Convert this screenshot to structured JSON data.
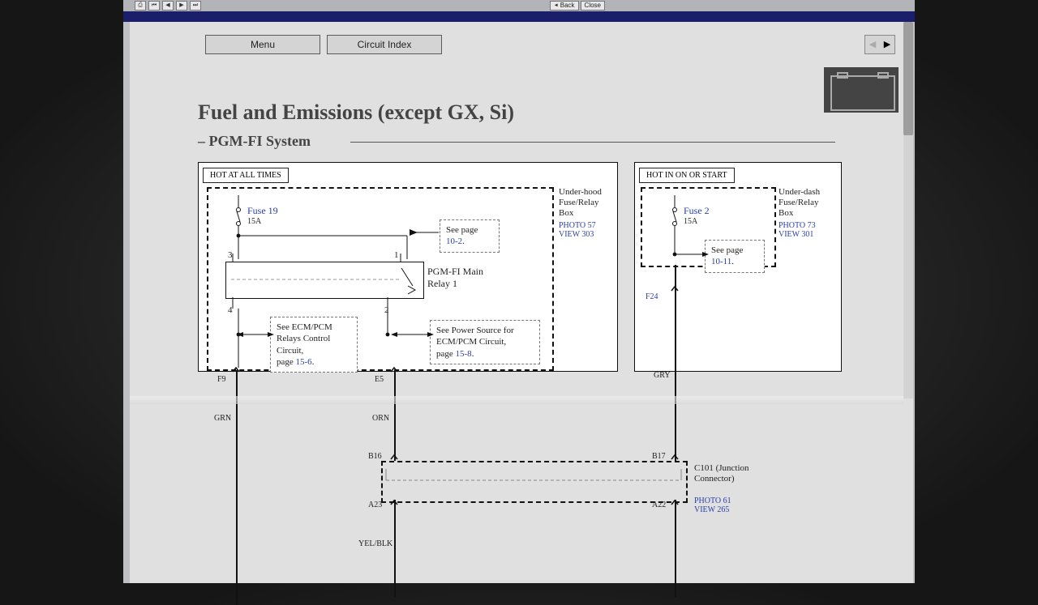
{
  "toolbar": {
    "back": "Back",
    "close": "Close"
  },
  "menu": {
    "item1": "Menu",
    "item2": "Circuit Index"
  },
  "title": "Fuel and Emissions (except GX, Si)",
  "subtitle": "– PGM-FI System",
  "panels": {
    "left": {
      "hot": "HOT AT ALL TIMES",
      "box_label": "Under-hood Fuse/Relay Box",
      "box_refs": [
        "PHOTO 57",
        "VIEW 303"
      ],
      "fuse": {
        "name": "Fuse 19",
        "rating": "15A"
      },
      "seepage1": {
        "pre": "See page",
        "page": "10-2",
        "post": "."
      },
      "relay": "PGM-FI Main Relay 1",
      "ref_left": {
        "text": "See ECM/PCM Relays Control Circuit,",
        "pagepre": "page",
        "page": "15-6",
        "post": "."
      },
      "ref_right": {
        "text": "See Power Source for ECM/PCM Circuit,",
        "pagepre": "page",
        "page": "15-8",
        "post": "."
      },
      "pins": {
        "p1": "1",
        "p2": "2",
        "p3": "3",
        "p4": "4"
      },
      "out_left": "F9",
      "out_right": "E5",
      "wire_left": "GRN",
      "wire_right": "ORN"
    },
    "right": {
      "hot": "HOT IN ON OR START",
      "box_label": "Under-dash Fuse/Relay Box",
      "box_refs": [
        "PHOTO 73",
        "VIEW 301"
      ],
      "fuse": {
        "name": "Fuse 2",
        "rating": "15A"
      },
      "seepage": {
        "pre": "See page",
        "page": "10-11",
        "post": "."
      },
      "out": "F24",
      "wire": "GRY"
    }
  },
  "junction": {
    "top_left": "B16",
    "top_right": "B17",
    "bot_left": "A23",
    "bot_right": "A22",
    "label": "C101 (Junction Connector)",
    "refs": [
      "PHOTO 61",
      "VIEW 265"
    ],
    "wire": "YEL/BLK"
  }
}
